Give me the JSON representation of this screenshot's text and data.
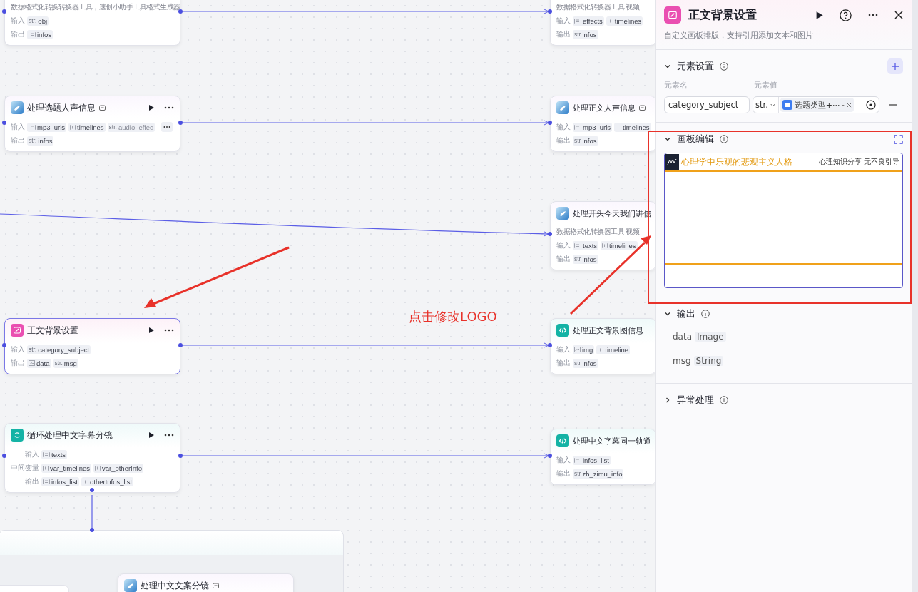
{
  "canvas": {
    "nodes": [
      {
        "kind": "tool",
        "description": "数据格式化转换转换器工具，速创小助手工具格式生成器",
        "rows": [
          {
            "label": "输入",
            "chips": [
              {
                "kind": "str",
                "prefix": "str.",
                "name": "obj"
              }
            ]
          },
          {
            "label": "输出",
            "chips": [
              {
                "kind": "obj_array",
                "name": "infos"
              }
            ]
          }
        ],
        "selected": false
      },
      {
        "kind": "plugin",
        "title": "处理选题人声信息",
        "tag": true,
        "actions": true,
        "rows": [
          {
            "label": "输入",
            "chips": [
              {
                "kind": "obj_array",
                "name": "mp3_urls"
              },
              {
                "kind": "array",
                "name": "timelines"
              },
              {
                "kind": "str",
                "prefix": "str.",
                "name": "audio_effec"
              }
            ]
          },
          {
            "label": "输出",
            "chips": [
              {
                "kind": "str",
                "prefix": "str.",
                "name": "infos"
              }
            ]
          }
        ],
        "more_chips": true,
        "selected": false
      },
      {
        "kind": "canvas",
        "title": "正文背景设置",
        "actions": true,
        "rows": [
          {
            "label": "输入",
            "chips": [
              {
                "kind": "str",
                "prefix": "str.",
                "name": "category_subject"
              }
            ]
          },
          {
            "label": "输出",
            "chips": [
              {
                "kind": "image",
                "name": "data"
              },
              {
                "kind": "str",
                "prefix": "str.",
                "name": "msg"
              }
            ]
          }
        ],
        "selected": true
      },
      {
        "kind": "loop",
        "title": "循环处理中文字幕分镜",
        "actions": true,
        "rows": [
          {
            "label": "输入",
            "chips": [
              {
                "kind": "obj_array",
                "name": "texts"
              }
            ]
          },
          {
            "label": "中间变量",
            "chips": [
              {
                "kind": "array",
                "name": "var_timelines"
              },
              {
                "kind": "array",
                "name": "var_otherInfo"
              }
            ]
          },
          {
            "label": "输出",
            "chips": [
              {
                "kind": "obj_array",
                "name": "infos_list"
              },
              {
                "kind": "array",
                "name": "otherInfos_list"
              }
            ]
          }
        ],
        "selected": false
      },
      {
        "kind": "tool",
        "description": "数据格式化转换器工具 视频",
        "rows": [
          {
            "label": "输入",
            "chips": [
              {
                "kind": "obj_array",
                "name": "effects"
              },
              {
                "kind": "array",
                "name": "timelines"
              }
            ]
          },
          {
            "label": "输出",
            "chips": [
              {
                "kind": "str",
                "prefix": "str",
                "name": "infos"
              }
            ]
          }
        ],
        "selected": false
      },
      {
        "kind": "plugin",
        "title": "处理正文人声信息",
        "tag": true,
        "rows": [
          {
            "label": "输入",
            "chips": [
              {
                "kind": "obj_array",
                "name": "mp3_urls"
              },
              {
                "kind": "array",
                "name": "timelines"
              }
            ]
          },
          {
            "label": "输出",
            "chips": [
              {
                "kind": "str",
                "prefix": "str",
                "name": "infos"
              }
            ]
          }
        ],
        "selected": false
      },
      {
        "kind": "plugin",
        "title": "处理开头今天我们讲信",
        "description": "数据格式化转换器工具 视频",
        "rows": [
          {
            "label": "输入",
            "chips": [
              {
                "kind": "obj_array",
                "name": "texts"
              },
              {
                "kind": "array",
                "name": "timelines"
              }
            ]
          },
          {
            "label": "输出",
            "chips": [
              {
                "kind": "str",
                "prefix": "str",
                "name": "infos"
              }
            ]
          }
        ],
        "selected": false
      },
      {
        "kind": "code",
        "title": "处理正文背景图信息",
        "rows": [
          {
            "label": "输入",
            "chips": [
              {
                "kind": "image",
                "name": "img"
              },
              {
                "kind": "array",
                "name": "timeline"
              }
            ]
          },
          {
            "label": "输出",
            "chips": [
              {
                "kind": "str",
                "prefix": "str",
                "name": "infos"
              }
            ]
          }
        ],
        "selected": false
      },
      {
        "kind": "code",
        "title": "处理中文字幕同一轨道",
        "rows": [
          {
            "label": "输入",
            "chips": [
              {
                "kind": "obj_array",
                "name": "infos_list"
              }
            ]
          },
          {
            "label": "输出",
            "chips": [
              {
                "kind": "str",
                "prefix": "str",
                "name": "zh_zimu_info"
              }
            ]
          }
        ],
        "selected": false
      },
      {
        "kind": "plugin",
        "title": "处理中文文案分镜",
        "tag": true,
        "selected": false
      }
    ],
    "annotation": {
      "text": "点击修改LOGO"
    }
  },
  "panel": {
    "title": "正文背景设置",
    "description": "自定义画板排版，支持引用添加文本和图片",
    "sections": [
      {
        "kind": "elements",
        "title": "元素设置",
        "expanded": true,
        "name_label": "元素名",
        "value_label": "元素值",
        "elements": [
          {
            "name": "category_subject",
            "type": "str.",
            "ref": "选题类型+···",
            "ref_suffix": "-"
          }
        ]
      },
      {
        "kind": "board",
        "title": "画板编辑",
        "expanded": true,
        "headline": "心理学中乐观的悲观主义人格",
        "tagline": "心理知识分享  无不良引导"
      },
      {
        "kind": "outputs",
        "title": "输出",
        "expanded": true,
        "outputs": [
          {
            "name": "data",
            "type": "Image"
          },
          {
            "name": "msg",
            "type": "String"
          }
        ]
      },
      {
        "kind": "errors",
        "title": "异常处理",
        "expanded": false
      }
    ]
  }
}
